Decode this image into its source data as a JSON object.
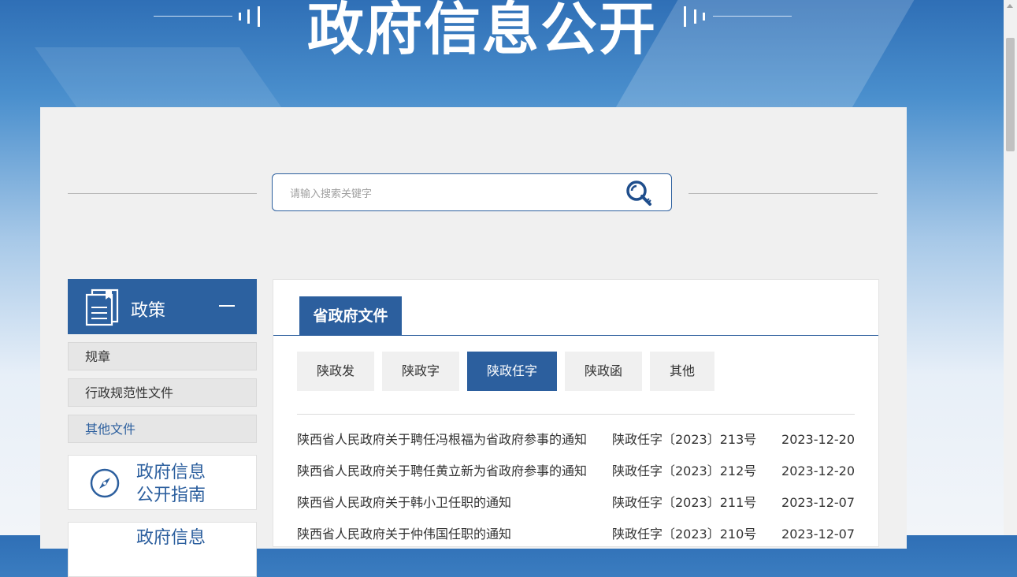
{
  "banner": {
    "title": "政府信息公开"
  },
  "search": {
    "placeholder": "请输入搜索关键字",
    "icon": "search-key-icon"
  },
  "sidebar": {
    "header": {
      "label": "政策",
      "icon": "document-icon",
      "toggle": "collapse-icon"
    },
    "items": [
      {
        "label": "规章"
      },
      {
        "label": "行政规范性文件"
      },
      {
        "label": "其他文件"
      }
    ],
    "cards": [
      {
        "label_line1": "政府信息",
        "label_line2": "公开指南",
        "icon": "compass-icon"
      },
      {
        "label_line1": "政府信息",
        "label_line2": ""
      }
    ]
  },
  "main": {
    "category": "省政府文件",
    "subtabs": [
      {
        "label": "陕政发"
      },
      {
        "label": "陕政字"
      },
      {
        "label": "陕政任字"
      },
      {
        "label": "陕政函"
      },
      {
        "label": "其他"
      }
    ],
    "active_subtab": "陕政任字",
    "documents": [
      {
        "title": "陕西省人民政府关于聘任冯根福为省政府参事的通知",
        "number": "陕政任字〔2023〕213号",
        "date": "2023-12-20"
      },
      {
        "title": "陕西省人民政府关于聘任黄立新为省政府参事的通知",
        "number": "陕政任字〔2023〕212号",
        "date": "2023-12-20"
      },
      {
        "title": "陕西省人民政府关于韩小卫任职的通知",
        "number": "陕政任字〔2023〕211号",
        "date": "2023-12-07"
      },
      {
        "title": "陕西省人民政府关于仲伟国任职的通知",
        "number": "陕政任字〔2023〕210号",
        "date": "2023-12-07"
      }
    ]
  },
  "colors": {
    "accent": "#2c5f9e",
    "panel": "#f0f0f0"
  }
}
